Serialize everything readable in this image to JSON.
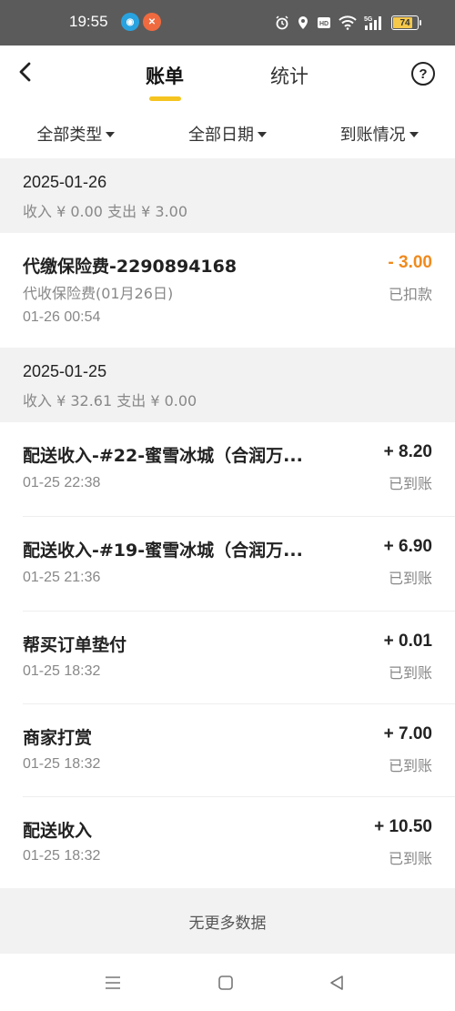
{
  "status_bar": {
    "time": "19:55",
    "app_icon_1": "notification-app-icon",
    "app_icon_2": "notification-app-icon",
    "battery": "74",
    "network_label": "5G"
  },
  "header": {
    "tab_active": "账单",
    "tab_inactive": "统计",
    "help": "?"
  },
  "filters": [
    {
      "label": "全部类型"
    },
    {
      "label": "全部日期"
    },
    {
      "label": "到账情况"
    }
  ],
  "days": [
    {
      "date": "2025-01-26",
      "summary": "收入 ¥ 0.00  支出 ¥ 3.00",
      "transactions": [
        {
          "title": "代缴保险费-2290894168",
          "subtitle": "代收保险费(01月26日)",
          "time": "01-26 00:54",
          "amount": "- 3.00",
          "status": "已扣款"
        }
      ]
    },
    {
      "date": "2025-01-25",
      "summary": "收入 ¥ 32.61  支出 ¥ 0.00",
      "transactions": [
        {
          "title": "配送收入-#22-蜜雪冰城（合润万...",
          "time": "01-25 22:38",
          "amount": "+ 8.20",
          "status": "已到账"
        },
        {
          "title": "配送收入-#19-蜜雪冰城（合润万...",
          "time": "01-25 21:36",
          "amount": "+ 6.90",
          "status": "已到账"
        },
        {
          "title": "帮买订单垫付",
          "time": "01-25 18:32",
          "amount": "+ 0.01",
          "status": "已到账"
        },
        {
          "title": "商家打赏",
          "time": "01-25 18:32",
          "amount": "+ 7.00",
          "status": "已到账"
        },
        {
          "title": "配送收入",
          "time": "01-25 18:32",
          "amount": "+ 10.50",
          "status": "已到账"
        }
      ]
    }
  ],
  "footer": {
    "no_more": "无更多数据"
  },
  "colors": {
    "accent": "#f5c420",
    "negative": "#f08a1e"
  },
  "nav_bar": {
    "icons": [
      "menu-icon",
      "home-square-icon",
      "back-triangle-icon"
    ]
  }
}
